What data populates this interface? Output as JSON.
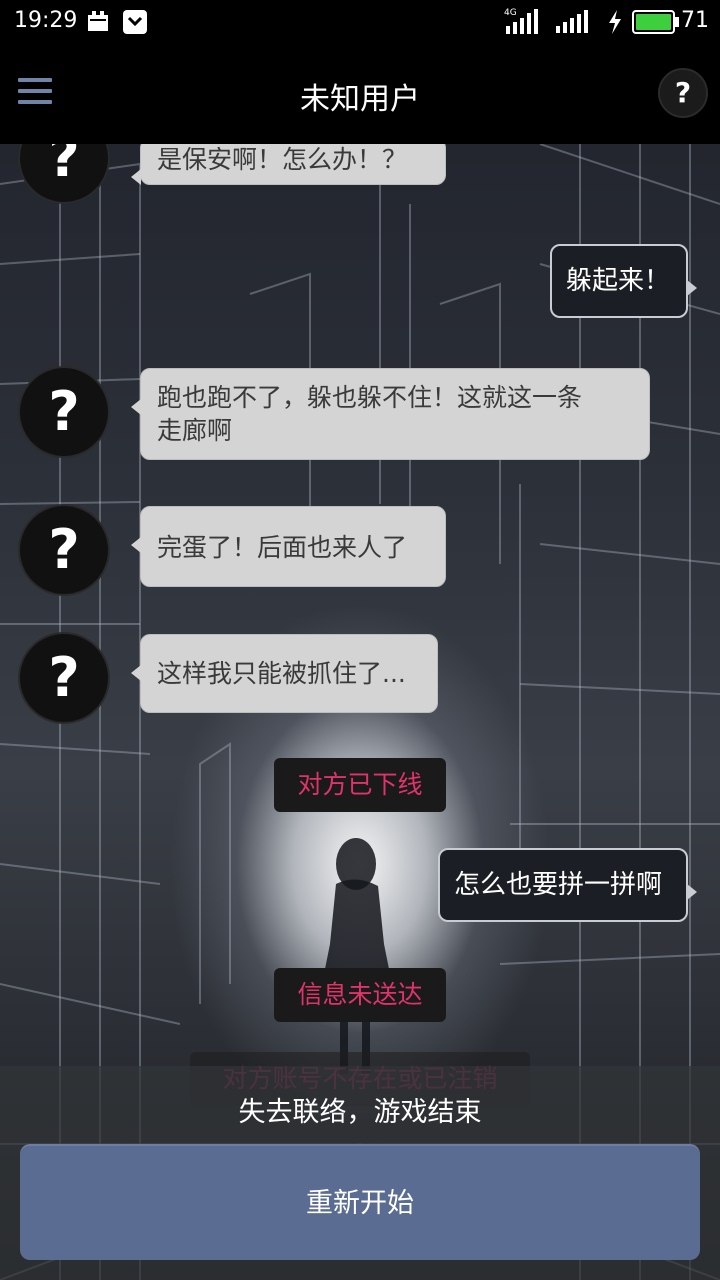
{
  "status_bar": {
    "time": "19:29",
    "network": "4G",
    "battery": "71",
    "icons": [
      "calendar-icon",
      "pocket-icon",
      "signal-4g-icon",
      "signal-icon",
      "charging-icon",
      "battery-icon"
    ]
  },
  "header": {
    "title": "未知用户",
    "menu_icon": "hamburger-menu-icon",
    "help_label": "?"
  },
  "avatar_glyph": "?",
  "messages": [
    {
      "from": "other",
      "text": "是保安啊！怎么办！？"
    },
    {
      "from": "me",
      "text": "躲起来！"
    },
    {
      "from": "other",
      "text": "跑也跑不了，躲也躲不住！这就这一条"
    },
    {
      "from": "other",
      "text": "走廊啊"
    },
    {
      "from": "other",
      "text": "完蛋了！后面也来人了"
    },
    {
      "from": "other",
      "text": "这样我只能被抓住了..."
    },
    {
      "from": "system",
      "text": "对方已下线"
    },
    {
      "from": "me",
      "text": "怎么也要拼一拼啊"
    },
    {
      "from": "system",
      "text": "信息未送达"
    },
    {
      "from": "system",
      "text": "对方账号不存在或已注销"
    }
  ],
  "game_over": {
    "text": "失去联络，游戏结束",
    "restart_label": "重新开始"
  },
  "colors": {
    "system_text": "#e0336a",
    "restart_button": "#5a6c91",
    "menu_icon": "#6f84a6",
    "battery_fill": "#3ecf3e"
  }
}
